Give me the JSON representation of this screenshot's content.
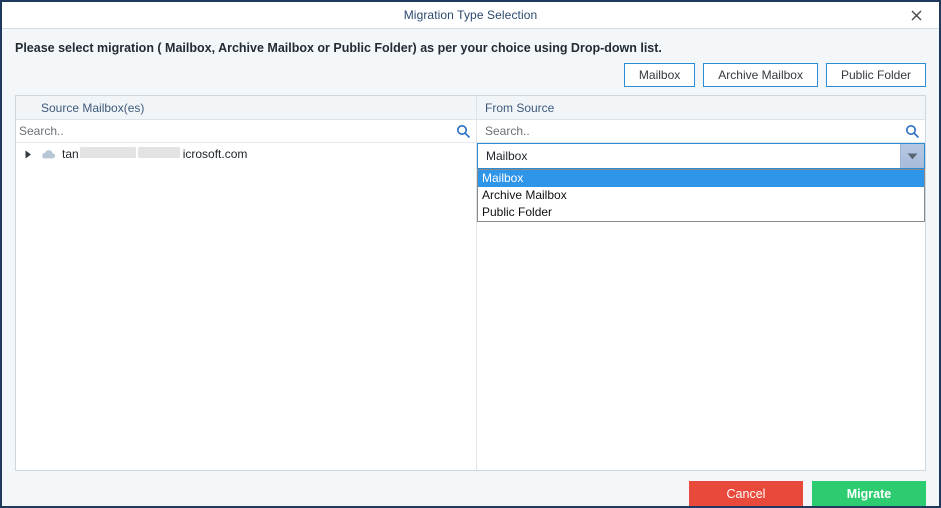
{
  "window": {
    "title": "Migration Type Selection",
    "close_icon": "close-icon"
  },
  "instruction": "Please select migration ( Mailbox, Archive Mailbox or Public Folder) as per your choice using Drop-down list.",
  "type_buttons": [
    {
      "label": "Mailbox"
    },
    {
      "label": "Archive Mailbox"
    },
    {
      "label": "Public Folder"
    }
  ],
  "columns": {
    "source": "Source Mailbox(es)",
    "from_source": "From Source"
  },
  "search": {
    "left_value": "",
    "left_placeholder": "Search..",
    "right_value": "",
    "right_placeholder": "Search..",
    "icon": "search-icon"
  },
  "tree": {
    "items": [
      {
        "prefix": "tan",
        "suffix": "icrosoft.com",
        "icon": "cloud-icon",
        "expander": "triangle-right-icon",
        "expanded": false
      }
    ]
  },
  "dropdown": {
    "selected": "Mailbox",
    "open": true,
    "arrow_icon": "chevron-down-icon",
    "options": [
      {
        "label": "Mailbox",
        "selected": true
      },
      {
        "label": "Archive Mailbox",
        "selected": false
      },
      {
        "label": "Public Folder",
        "selected": false
      }
    ]
  },
  "footer": {
    "cancel": "Cancel",
    "migrate": "Migrate"
  },
  "colors": {
    "window_border": "#1f3a5c",
    "accent_blue": "#2b8cd4",
    "cancel_red": "#e8493a",
    "migrate_green": "#2ecc71",
    "highlight_blue": "#2f95e8",
    "header_text": "#3d5a7c"
  }
}
